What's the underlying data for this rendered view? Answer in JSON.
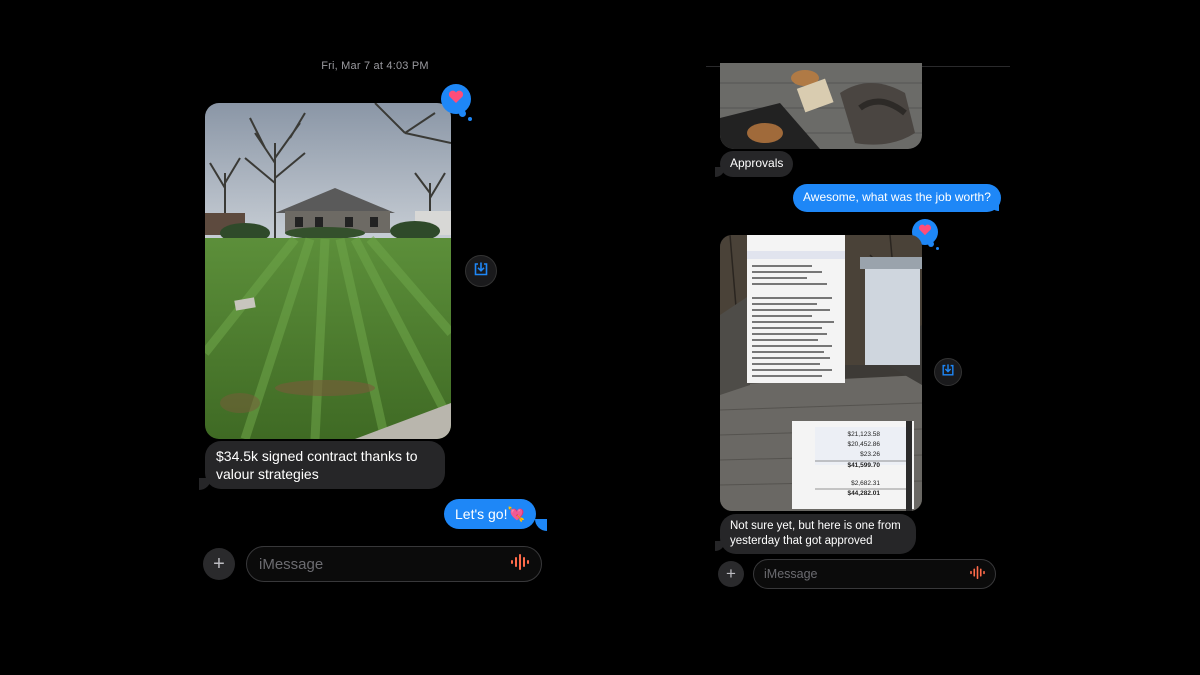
{
  "left": {
    "timestamp": "Fri, Mar 7 at 4:03 PM",
    "received_message": "$34.5k signed contract thanks to valour strategies",
    "sent_message": "Let's go!💘",
    "photo_description": "lawn-photo",
    "tapback_icon": "heart-icon",
    "input_placeholder": "iMessage"
  },
  "right": {
    "received_label": "Approvals",
    "sent_message": "Awesome, what was the job worth?",
    "received_message": "Not sure yet, but here is one from yesterday that got approved",
    "tapback_icon": "heart-icon",
    "input_placeholder": "iMessage",
    "document_header": "Estimate",
    "amounts": [
      "$21,123.58",
      "$20,452.86",
      "$23.26",
      "$41,599.70",
      "$2,682.31",
      "$44,282.01"
    ]
  },
  "colors": {
    "blue_bubble": "#1e87f7",
    "gray_bubble": "#262628",
    "heart": "#ff4d7a",
    "waveform": "#ff6b4a"
  }
}
